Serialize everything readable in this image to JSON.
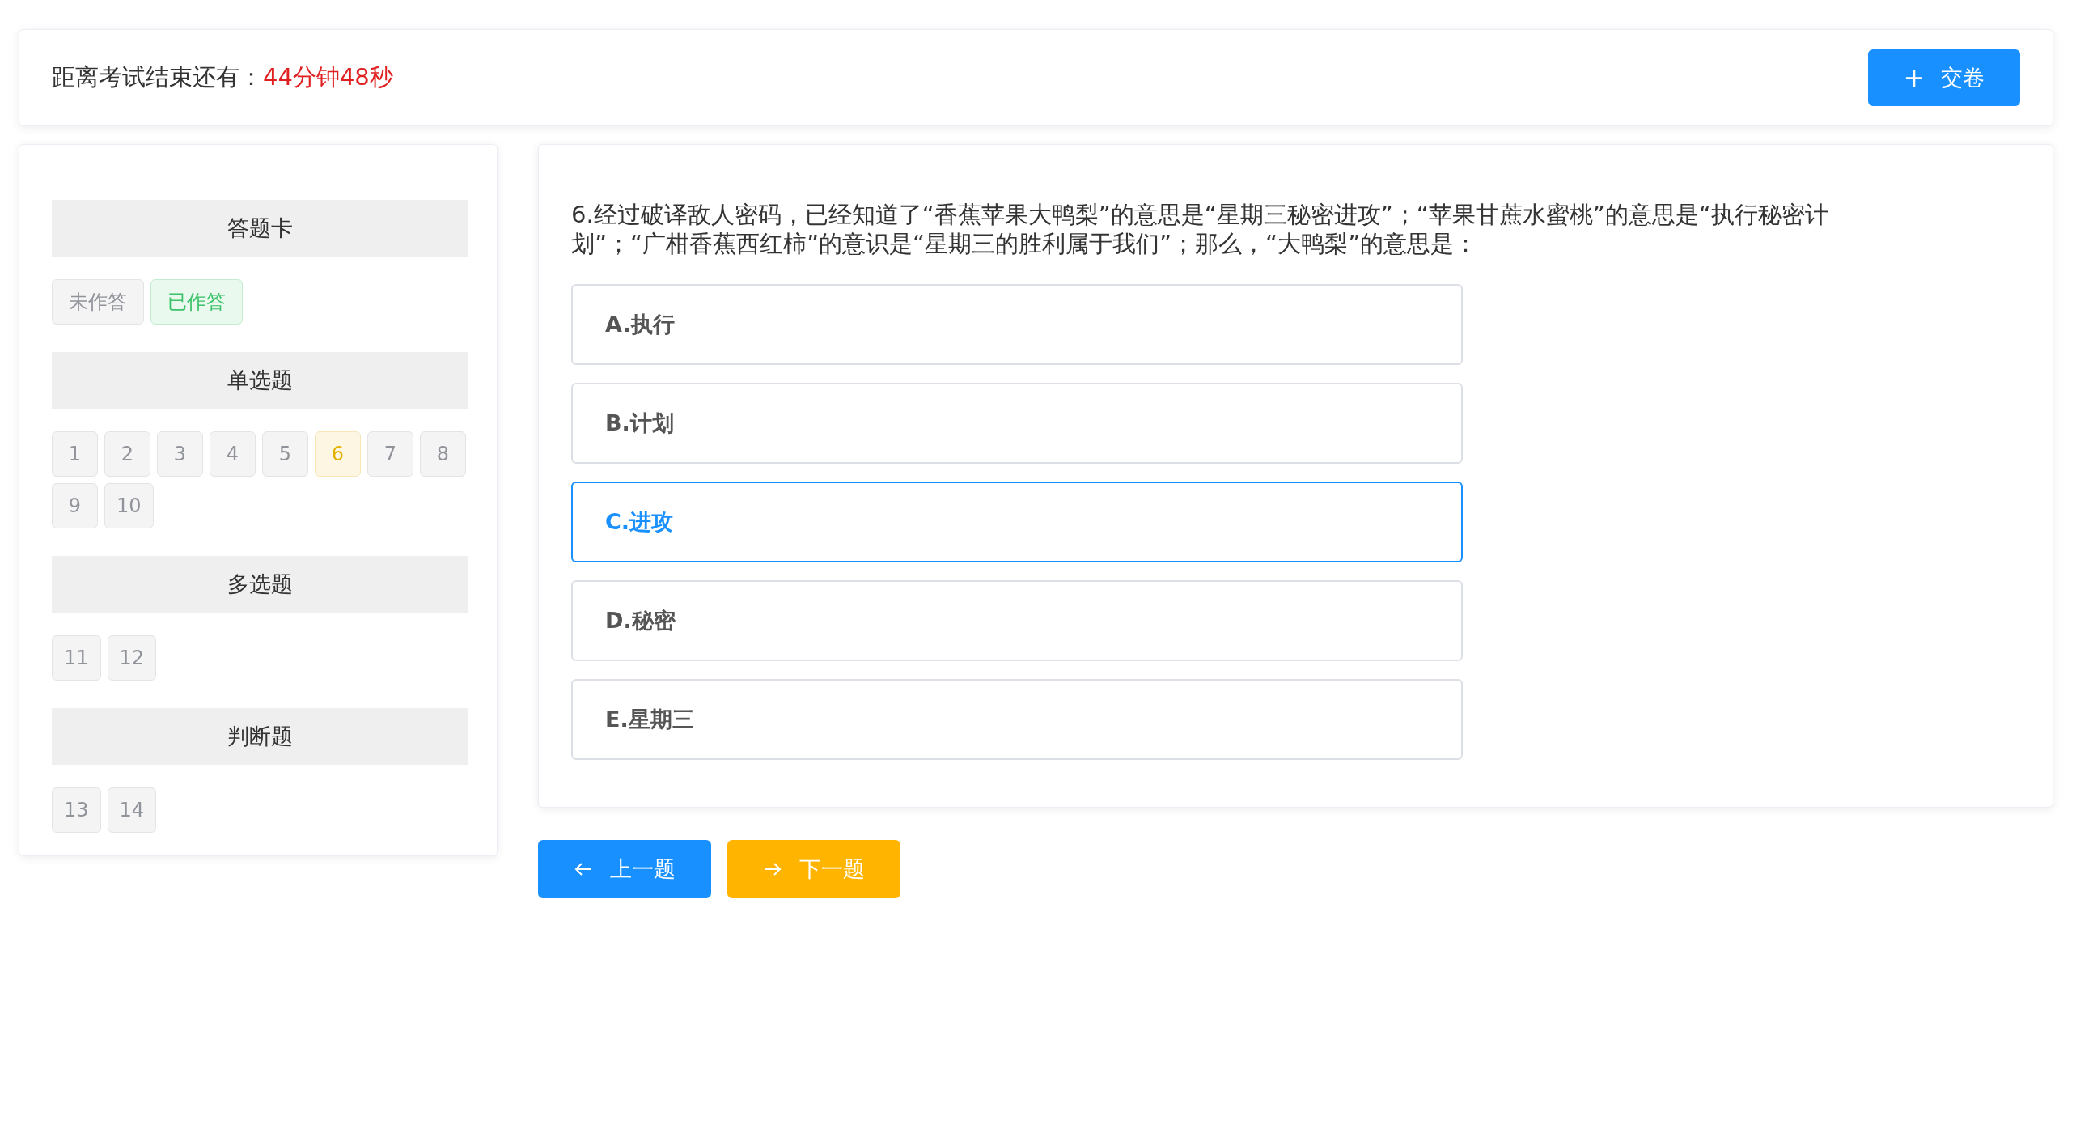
{
  "timer": {
    "label": "距离考试结束还有：",
    "remaining": "44分钟48秒"
  },
  "submit_button": {
    "icon": "+",
    "label": "交卷"
  },
  "answer_card": {
    "title": "答题卡",
    "legend": [
      {
        "label": "未作答",
        "kind": "unanswered"
      },
      {
        "label": "已作答",
        "kind": "answered"
      }
    ],
    "sections": [
      {
        "title": "单选题",
        "questions": [
          {
            "number": "1",
            "kind": "unanswered"
          },
          {
            "number": "2",
            "kind": "unanswered"
          },
          {
            "number": "3",
            "kind": "unanswered"
          },
          {
            "number": "4",
            "kind": "unanswered"
          },
          {
            "number": "5",
            "kind": "unanswered"
          },
          {
            "number": "6",
            "kind": "current"
          },
          {
            "number": "7",
            "kind": "unanswered"
          },
          {
            "number": "8",
            "kind": "unanswered"
          },
          {
            "number": "9",
            "kind": "unanswered"
          },
          {
            "number": "10",
            "kind": "unanswered"
          }
        ]
      },
      {
        "title": "多选题",
        "questions": [
          {
            "number": "11",
            "kind": "unanswered"
          },
          {
            "number": "12",
            "kind": "unanswered"
          }
        ]
      },
      {
        "title": "判断题",
        "questions": [
          {
            "number": "13",
            "kind": "unanswered"
          },
          {
            "number": "14",
            "kind": "unanswered"
          }
        ]
      }
    ]
  },
  "question": {
    "text": "6.经过破译敌人密码，已经知道了“香蕉苹果大鸭梨”的意思是“星期三秘密进攻”；“苹果甘蔗水蜜桃”的意思是“执行秘密计划”；“广柑香蕉西红柿”的意识是“星期三的胜利属于我们”；那么，“大鸭梨”的意思是：",
    "options": [
      {
        "label": "A.执行",
        "selected": false
      },
      {
        "label": "B.计划",
        "selected": false
      },
      {
        "label": "C.进攻",
        "selected": true
      },
      {
        "label": "D.秘密",
        "selected": false
      },
      {
        "label": "E.星期三",
        "selected": false
      }
    ]
  },
  "navigation": [
    {
      "kind": "previous",
      "label": "上一题"
    },
    {
      "kind": "next",
      "label": "下一题"
    }
  ]
}
